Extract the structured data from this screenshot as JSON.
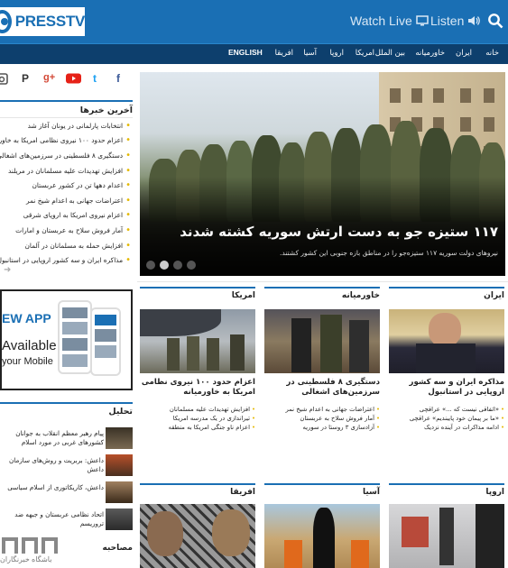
{
  "header": {
    "logo_text": "PRESSTV",
    "watch_live": "Watch Live",
    "listen": "Listen",
    "colors": {
      "bar": "#1a6fb4",
      "nav": "#0d3f6d",
      "accent": "#e4b800"
    }
  },
  "nav": {
    "items": [
      "خانه",
      "ایران",
      "خاورمیانه",
      "بین الملل",
      "امریکا",
      "اروپا",
      "آسیا",
      "افریقا",
      "ENGLISH"
    ]
  },
  "social": [
    "instagram-icon",
    "pinterest-icon",
    "googleplus-icon",
    "youtube-icon",
    "twitter-icon",
    "facebook-icon"
  ],
  "latest": {
    "title": "آخرین خبرها",
    "items": [
      "انتخابات پارلمانی در یونان آغاز شد",
      "اعزام حدود ۱۰۰ نیروی نظامی امریکا به خاورمیانه",
      "دستگیری ۸ فلسطینی در سرزمین‌های اشغالی",
      "افزایش تهدیدات علیه مسلمانان در مریلند",
      "اعدام دهها تن در کشور عربستان",
      "اعتراضات جهانی به اعدام شیخ نمر",
      "اعزام نیروی امریکا به اروپای شرقی",
      "آمار فروش سلاح به عربستان و امارات",
      "افزایش حمله به مسلمانان در آلمان",
      "مذاکره ایران و سه کشور اروپایی در استانبول"
    ]
  },
  "ad": {
    "line1": "EW APP",
    "line2": "Available",
    "line3": "your Mobile"
  },
  "hero": {
    "title": "۱۱۷ ستیزه جو به دست ارتش سوریه کشته شدند",
    "subtitle": "نیروهای دولت سوریه ۱۱۷ ستیزه‌جو را در مناطق بازه جنوبی این کشور کشتند.",
    "slide_index": 2,
    "slide_count": 4
  },
  "analysis": {
    "title": "تحلیل",
    "items": [
      "پیام رهبر معظم انقلاب به جوانان کشورهای غربی در مورد اسلام",
      "داعش: بربریت و روش‌های سازمان داعش",
      "داعش، کاریکاتوری از اسلام سیاسی",
      "اتحاد نظامی عربستان و جبهه ضد تروریسم"
    ]
  },
  "watermark": "باشگاه خبرنگاران",
  "sections": [
    {
      "name": "ایران",
      "headline": "مذاکره ایران و سه کشور اروپایی در استانبول",
      "bullets": [
        "«اتفاقی نیست که ...» عراقچی",
        "«ما بر پیمان خود پایبندیم» عراقچی",
        "ادامه مذاکرات در آینده نزدیک"
      ]
    },
    {
      "name": "خاورمیانه",
      "headline": "دستگیری ۸ فلسطینی در سرزمین‌های اشغالی",
      "bullets": [
        "اعتراضات جهانی به اعدام شیخ نمر",
        "آمار فروش سلاح به عربستان",
        "آزادسازی ۳ روستا در سوریه"
      ]
    },
    {
      "name": "امریکا",
      "headline": "اعزام حدود ۱۰۰ نیروی نظامی امریکا به خاورمیانه",
      "bullets": [
        "افزایش تهدیدات علیه مسلمانان",
        "تیراندازی در یک مدرسه امریکا",
        "اعزام ناو جنگی امریکا به منطقه"
      ]
    },
    {
      "name": "اروپا"
    },
    {
      "name": "آسیا"
    },
    {
      "name": "افریقا"
    },
    {
      "name": "مصاحبه"
    }
  ]
}
